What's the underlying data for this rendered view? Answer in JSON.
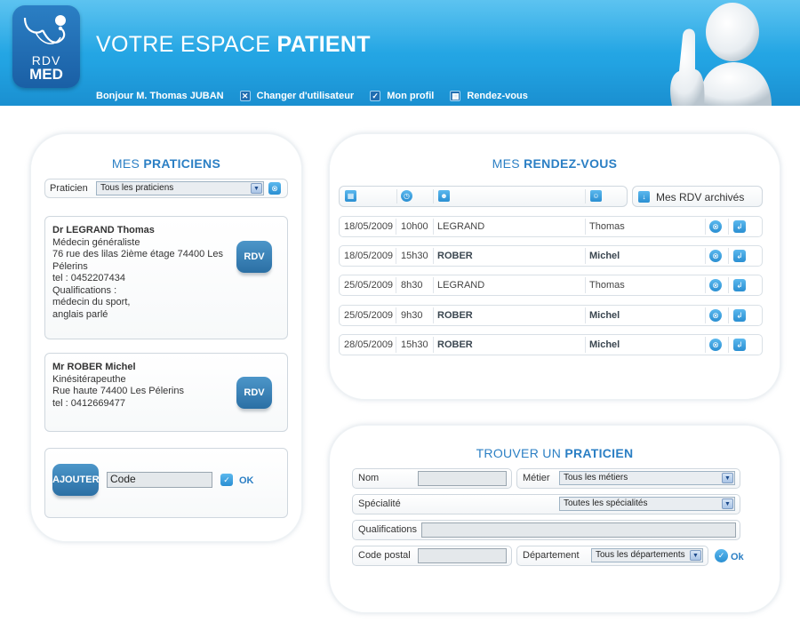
{
  "header": {
    "title_light": "VOTRE ESPACE ",
    "title_bold": "PATIENT",
    "logo_top": "RDV",
    "logo_bottom": "MED",
    "nav": {
      "greeting": "Bonjour M. Thomas JUBAN",
      "change_user": "Changer d'utilisateur",
      "profile": "Mon profil",
      "appointments": "Rendez-vous"
    }
  },
  "praticiens": {
    "title_light": "MES ",
    "title_bold": "PRATICIENS",
    "filter_label": "Praticien",
    "filter_value": "Tous les praticiens",
    "rdv_button": "RDV",
    "doctors": [
      {
        "name": "Dr LEGRAND Thomas",
        "lines": [
          "Médecin généraliste",
          "76 rue des lilas 2ième étage 74400 Les",
          "Pélerins",
          "tel : 0452207434",
          "Qualifications :",
          "médecin du sport,",
          "anglais parlé"
        ]
      },
      {
        "name": "Mr ROBER Michel",
        "lines": [
          "Kinésitérapeuthe",
          "Rue haute 74400 Les Pélerins",
          "tel : 0412669477"
        ]
      }
    ],
    "add_button": "AJOUTER",
    "code_value": "Code",
    "ok_label": "OK"
  },
  "rendezvous": {
    "title_light": "MES ",
    "title_bold": "RENDEZ-VOUS",
    "archive_label": "Mes RDV archivés",
    "rows": [
      {
        "date": "18/05/2009",
        "time": "10h00",
        "last": "LEGRAND",
        "first": "Thomas",
        "bold": false
      },
      {
        "date": "18/05/2009",
        "time": "15h30",
        "last": "ROBER",
        "first": "Michel",
        "bold": true
      },
      {
        "date": "25/05/2009",
        "time": "8h30",
        "last": "LEGRAND",
        "first": "Thomas",
        "bold": false
      },
      {
        "date": "25/05/2009",
        "time": "9h30",
        "last": "ROBER",
        "first": "Michel",
        "bold": true
      },
      {
        "date": "28/05/2009",
        "time": "15h30",
        "last": "ROBER",
        "first": "Michel",
        "bold": true
      }
    ]
  },
  "search": {
    "title_light": "TROUVER UN ",
    "title_bold": "PRATICIEN",
    "nom_label": "Nom",
    "metier_label": "Métier",
    "metier_value": "Tous les métiers",
    "specialite_label": "Spécialité",
    "specialite_value": "Toutes les spécialités",
    "qualifications_label": "Qualifications",
    "code_postal_label": "Code postal",
    "departement_label": "Département",
    "departement_value": "Tous les départements",
    "ok_label": "Ok"
  },
  "colors": {
    "header_blue": "#22a3e2",
    "accent_blue": "#2b7fc4",
    "button_blue": "#2b6fa4"
  }
}
